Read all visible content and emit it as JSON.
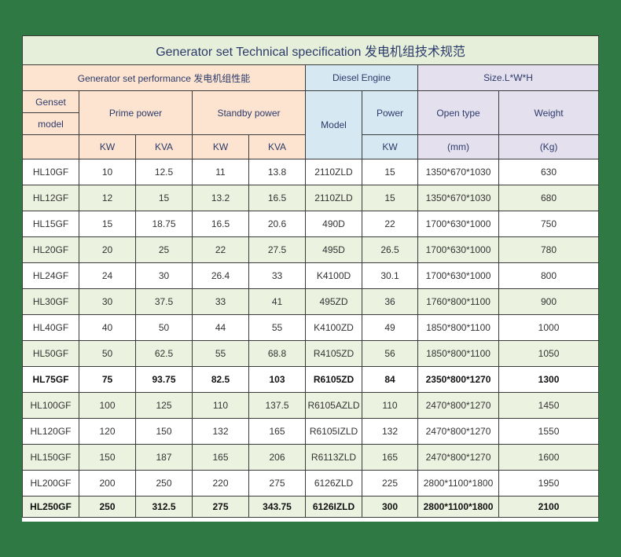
{
  "title": "Generator set Technical specification 发电机组技术规范",
  "groups": {
    "performance": "Generator set performance 发电机组性能",
    "diesel": "Diesel  Engine",
    "size": "Size.L*W*H"
  },
  "headers": {
    "genset_line1": "Genset",
    "genset_line2": "model",
    "prime": "Prime power",
    "standby": "Standby power",
    "model": "Model",
    "power": "Power",
    "open_type": "Open type",
    "weight": "Weight"
  },
  "units": {
    "prime_kw": "KW",
    "prime_kva": "KVA",
    "standby_kw": "KW",
    "standby_kva": "KVA",
    "power_kw": "KW",
    "open_mm": "(mm)",
    "weight_kg": "(Kg)"
  },
  "colors": {
    "background": "#2f7a44",
    "title_band": "#e6efd9",
    "performance_band": "#fde4d0",
    "diesel_band": "#d6e9f2",
    "size_band": "#e4e0ee",
    "alt_row": "#ecf2e0"
  },
  "rows": [
    {
      "model": "HL10GF",
      "prime_kw": "10",
      "prime_kva": "12.5",
      "standby_kw": "11",
      "standby_kva": "13.8",
      "engine": "2110ZLD",
      "engine_kw": "15",
      "dims": "1350*670*1030",
      "weight": "630"
    },
    {
      "model": "HL12GF",
      "prime_kw": "12",
      "prime_kva": "15",
      "standby_kw": "13.2",
      "standby_kva": "16.5",
      "engine": "2110ZLD",
      "engine_kw": "15",
      "dims": "1350*670*1030",
      "weight": "680"
    },
    {
      "model": "HL15GF",
      "prime_kw": "15",
      "prime_kva": "18.75",
      "standby_kw": "16.5",
      "standby_kva": "20.6",
      "engine": "490D",
      "engine_kw": "22",
      "dims": "1700*630*1000",
      "weight": "750"
    },
    {
      "model": "HL20GF",
      "prime_kw": "20",
      "prime_kva": "25",
      "standby_kw": "22",
      "standby_kva": "27.5",
      "engine": "495D",
      "engine_kw": "26.5",
      "dims": "1700*630*1000",
      "weight": "780"
    },
    {
      "model": "HL24GF",
      "prime_kw": "24",
      "prime_kva": "30",
      "standby_kw": "26.4",
      "standby_kva": "33",
      "engine": "K4100D",
      "engine_kw": "30.1",
      "dims": "1700*630*1000",
      "weight": "800"
    },
    {
      "model": "HL30GF",
      "prime_kw": "30",
      "prime_kva": "37.5",
      "standby_kw": "33",
      "standby_kva": "41",
      "engine": "495ZD",
      "engine_kw": "36",
      "dims": "1760*800*1100",
      "weight": "900"
    },
    {
      "model": "HL40GF",
      "prime_kw": "40",
      "prime_kva": "50",
      "standby_kw": "44",
      "standby_kva": "55",
      "engine": "K4100ZD",
      "engine_kw": "49",
      "dims": "1850*800*1100",
      "weight": "1000"
    },
    {
      "model": "HL50GF",
      "prime_kw": "50",
      "prime_kva": "62.5",
      "standby_kw": "55",
      "standby_kva": "68.8",
      "engine": "R4105ZD",
      "engine_kw": "56",
      "dims": "1850*800*1100",
      "weight": "1050"
    },
    {
      "model": "HL75GF",
      "prime_kw": "75",
      "prime_kva": "93.75",
      "standby_kw": "82.5",
      "standby_kva": "103",
      "engine": "R6105ZD",
      "engine_kw": "84",
      "dims": "2350*800*1270",
      "weight": "1300"
    },
    {
      "model": "HL100GF",
      "prime_kw": "100",
      "prime_kva": "125",
      "standby_kw": "110",
      "standby_kva": "137.5",
      "engine": "R6105AZLD",
      "engine_kw": "110",
      "dims": "2470*800*1270",
      "weight": "1450"
    },
    {
      "model": "HL120GF",
      "prime_kw": "120",
      "prime_kva": "150",
      "standby_kw": "132",
      "standby_kva": "165",
      "engine": "R6105IZLD",
      "engine_kw": "132",
      "dims": "2470*800*1270",
      "weight": "1550"
    },
    {
      "model": "HL150GF",
      "prime_kw": "150",
      "prime_kva": "187",
      "standby_kw": "165",
      "standby_kva": "206",
      "engine": "R6113ZLD",
      "engine_kw": "165",
      "dims": "2470*800*1270",
      "weight": "1600"
    },
    {
      "model": "HL200GF",
      "prime_kw": "200",
      "prime_kva": "250",
      "standby_kw": "220",
      "standby_kva": "275",
      "engine": "6126ZLD",
      "engine_kw": "225",
      "dims": "2800*1100*1800",
      "weight": "1950"
    },
    {
      "model": "HL250GF",
      "prime_kw": "250",
      "prime_kva": "312.5",
      "standby_kw": "275",
      "standby_kva": "343.75",
      "engine": "6126IZLD",
      "engine_kw": "300",
      "dims": "2800*1100*1800",
      "weight": "2100"
    }
  ]
}
